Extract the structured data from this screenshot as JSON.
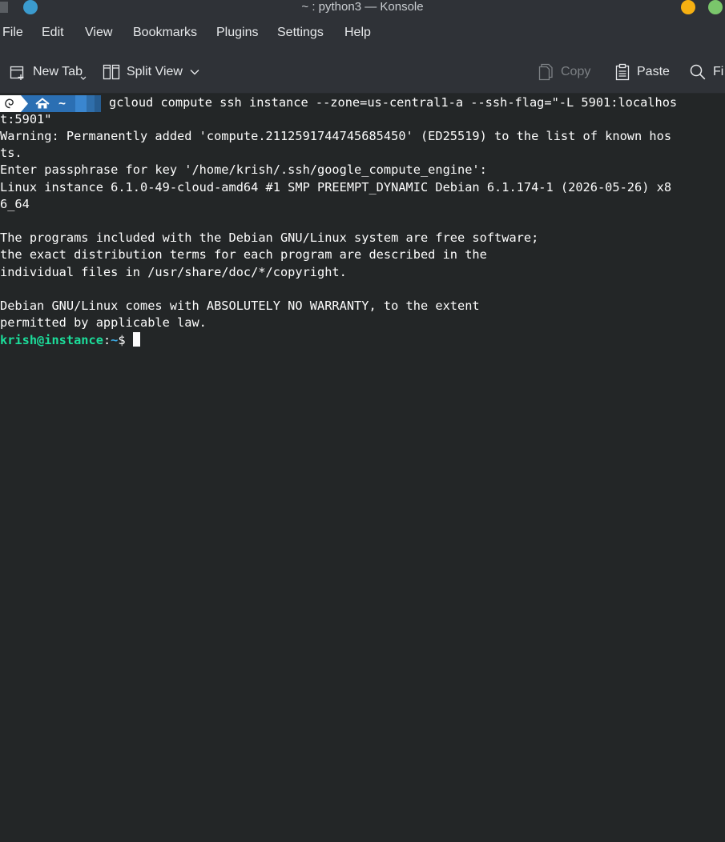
{
  "window": {
    "title": "~ : python3 — Konsole"
  },
  "menu": {
    "file": "File",
    "edit": "Edit",
    "view": "View",
    "bookmarks": "Bookmarks",
    "plugins": "Plugins",
    "settings": "Settings",
    "help": "Help"
  },
  "toolbar": {
    "new_tab": "New Tab",
    "split_view": "Split View",
    "copy": "Copy",
    "paste": "Paste",
    "find_partial": "Fi"
  },
  "prompt": {
    "home_symbol": "~",
    "command": "gcloud compute ssh instance --zone=us-central1-a --ssh-flag=\"-L 5901:localhos"
  },
  "output": {
    "line_02": "t:5901\"",
    "line_03": "Warning: Permanently added 'compute.2112591744745685450' (ED25519) to the list of known hos",
    "line_04": "ts.",
    "line_05": "Enter passphrase for key '/home/krish/.ssh/google_compute_engine':",
    "line_06": "Linux instance 6.1.0-49-cloud-amd64 #1 SMP PREEMPT_DYNAMIC Debian 6.1.174-1 (2026-05-26) x8",
    "line_07": "6_64",
    "line_09": "The programs included with the Debian GNU/Linux system are free software;",
    "line_10": "the exact distribution terms for each program are described in the",
    "line_11": "individual files in /usr/share/doc/*/copyright.",
    "line_13": "Debian GNU/Linux comes with ABSOLUTELY NO WARRANTY, to the extent",
    "line_14": "permitted by applicable law."
  },
  "remote_prompt": {
    "user_host": "krish@instance",
    "separator": ":",
    "path": "~",
    "symbol": "$ "
  },
  "colors": {
    "terminal_bg": "#232627",
    "chrome_bg": "#2f3237",
    "prompt_green": "#1cdc9a",
    "prompt_blue": "#3daee9",
    "minimize": "#f6b012",
    "maximize": "#7ac66b"
  }
}
